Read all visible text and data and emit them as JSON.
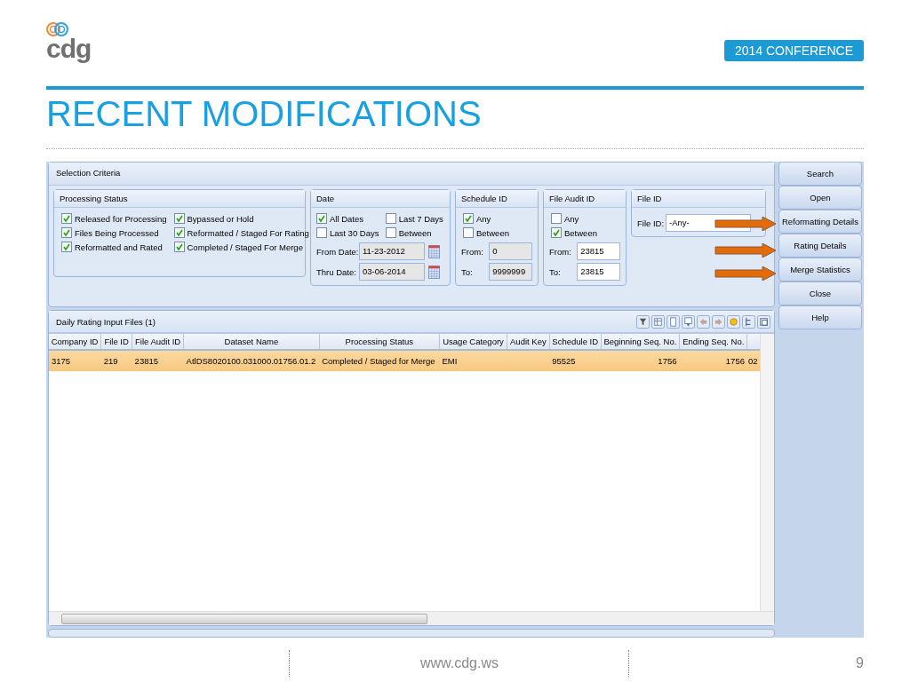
{
  "slide": {
    "logo": "cdg",
    "badge": "2014 CONFERENCE",
    "title": "RECENT MODIFICATIONS",
    "footer": "www.cdg.ws",
    "page": "9"
  },
  "app": {
    "selection_title": "Selection Criteria",
    "processing_status": {
      "title": "Processing Status",
      "options": [
        {
          "label": "Released for Processing",
          "checked": true
        },
        {
          "label": "Bypassed or Hold",
          "checked": true
        },
        {
          "label": "Files Being Processed",
          "checked": true
        },
        {
          "label": "Reformatted / Staged For Rating",
          "checked": true
        },
        {
          "label": "Reformatted and Rated",
          "checked": true
        },
        {
          "label": "Completed / Staged For Merge",
          "checked": true
        }
      ]
    },
    "date": {
      "title": "Date",
      "options": [
        {
          "label": "All Dates",
          "checked": true
        },
        {
          "label": "Last 7 Days",
          "checked": false
        },
        {
          "label": "Last 30 Days",
          "checked": false
        },
        {
          "label": "Between",
          "checked": false
        }
      ],
      "fields": [
        {
          "label": "From Date:",
          "value": "11-23-2012",
          "disabled": true
        },
        {
          "label": "Thru Date:",
          "value": "03-06-2014",
          "disabled": true
        }
      ]
    },
    "schedule_id": {
      "title": "Schedule ID",
      "options": [
        {
          "label": "Any",
          "checked": true
        },
        {
          "label": "Between",
          "checked": false
        }
      ],
      "fields": [
        {
          "label": "From:",
          "value": "0",
          "disabled": true
        },
        {
          "label": "To:",
          "value": "9999999",
          "disabled": true
        }
      ]
    },
    "file_audit_id": {
      "title": "File Audit ID",
      "options": [
        {
          "label": "Any",
          "checked": false
        },
        {
          "label": "Between",
          "checked": true
        }
      ],
      "fields": [
        {
          "label": "From:",
          "value": "23815",
          "disabled": false
        },
        {
          "label": "To:",
          "value": "23815",
          "disabled": false
        }
      ]
    },
    "file_id": {
      "title": "File ID",
      "label": "File ID:",
      "value": "-Any-"
    },
    "buttons": [
      "Search",
      "Open",
      "Reformatting Details",
      "Rating Details",
      "Merge Statistics",
      "Close",
      "Help"
    ],
    "grid": {
      "title": "Daily Rating Input Files (1)",
      "columns": [
        {
          "label": "Company ID",
          "kind": "text"
        },
        {
          "label": "File ID",
          "kind": "text"
        },
        {
          "label": "File Audit ID",
          "kind": "text"
        },
        {
          "label": "Dataset Name",
          "kind": "text"
        },
        {
          "label": "Processing Status",
          "kind": "text"
        },
        {
          "label": "Usage Category",
          "kind": "text"
        },
        {
          "label": "Audit Key",
          "kind": "text"
        },
        {
          "label": "Schedule ID",
          "kind": "text"
        },
        {
          "label": "Beginning Seq. No.",
          "kind": "number"
        },
        {
          "label": "Ending Seq. No.",
          "kind": "number"
        }
      ],
      "rows": [
        {
          "selected": true,
          "cells": [
            "3175",
            "219",
            "23815",
            "AtlDS8020100.031000.01756.01.2",
            "Completed / Staged for Merge",
            "EMI",
            "",
            "95525",
            "1756",
            "1756"
          ],
          "extra": "02"
        }
      ]
    }
  }
}
